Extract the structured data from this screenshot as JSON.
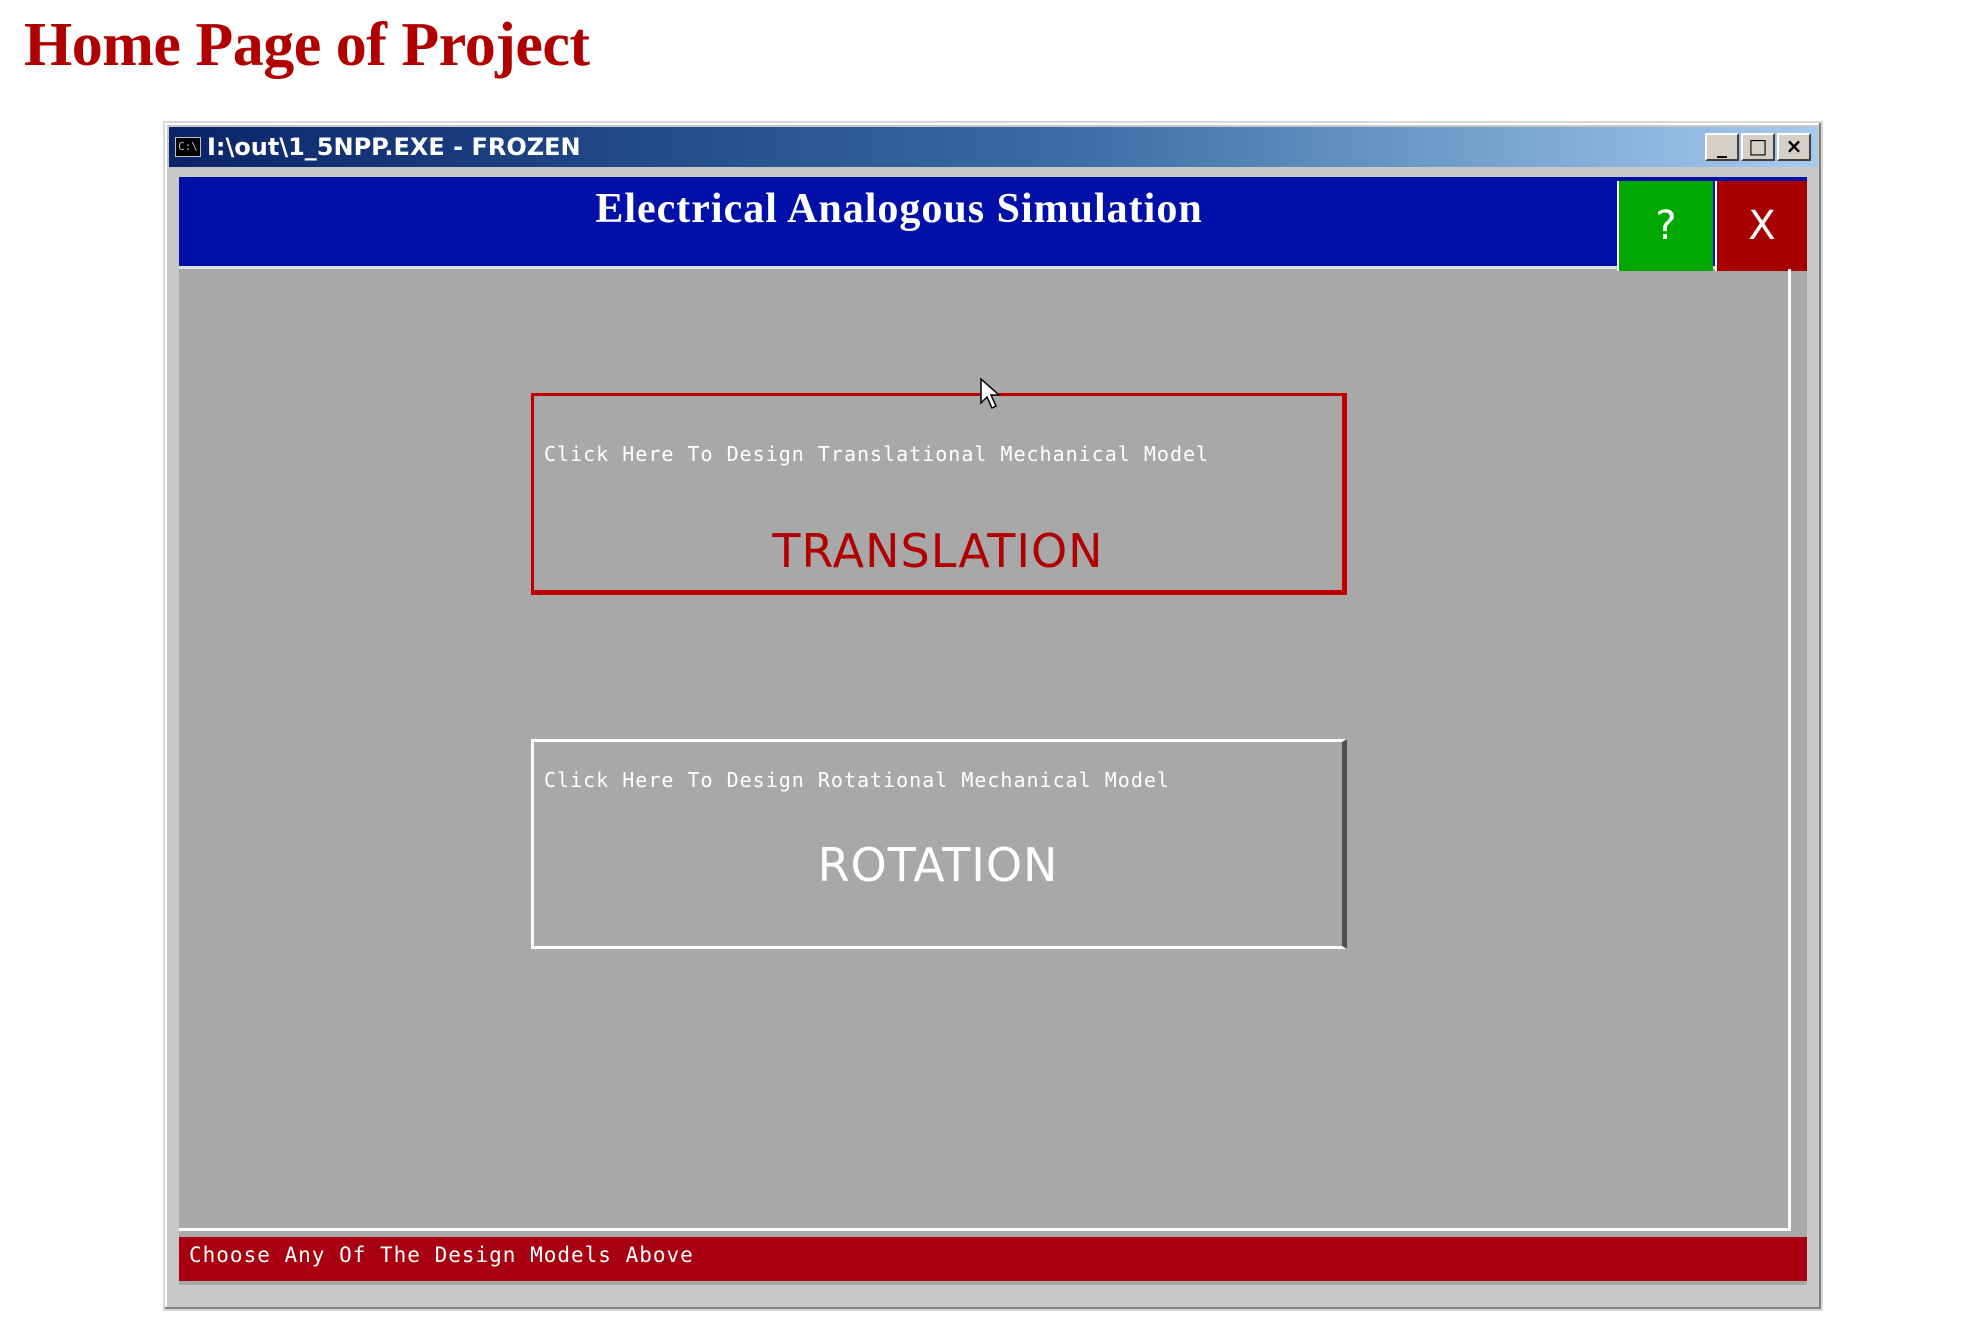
{
  "page": {
    "title": "Home Page of Project"
  },
  "window": {
    "title": "I:\\out\\1_5NPP.EXE - FROZEN",
    "icon": "console-icon",
    "icon_glyph": "C:\\",
    "controls": {
      "minimize": "_",
      "maximize": "□",
      "close": "×"
    }
  },
  "app": {
    "header_title": "Electrical Analogous Simulation",
    "help_label": "?",
    "close_label": "X",
    "colors": {
      "header_bg": "#0010a8",
      "help_bg": "#00a800",
      "close_bg": "#a80000",
      "client_bg": "#a8a8a8",
      "status_bg": "#a80010",
      "translation_accent": "#b00000"
    }
  },
  "models": {
    "translation": {
      "hint": "Click Here To Design Translational Mechanical Model",
      "label": "TRANSLATION"
    },
    "rotation": {
      "hint": "Click Here To Design Rotational Mechanical Model",
      "label": "ROTATION"
    }
  },
  "status": {
    "text": "Choose Any Of The Design Models Above"
  }
}
